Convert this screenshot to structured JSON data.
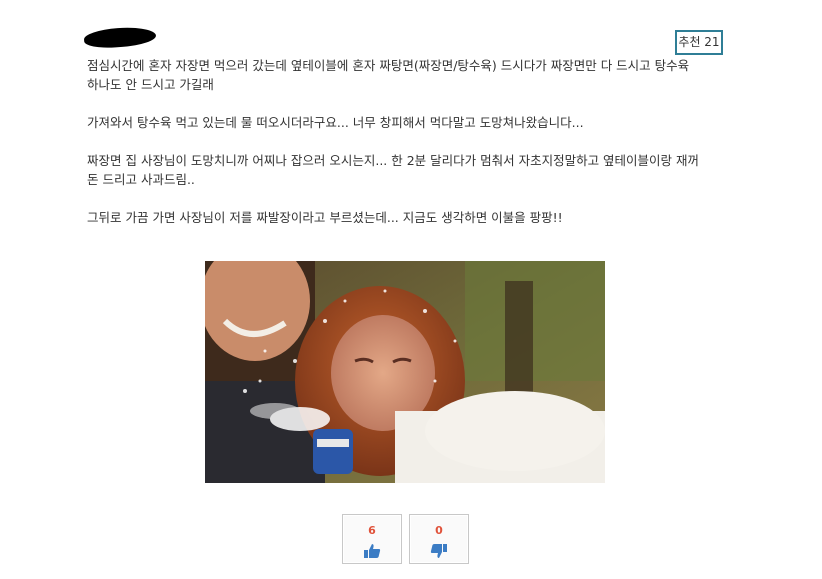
{
  "post": {
    "recommend_label": "추천 21",
    "paragraphs": [
      "점심시간에 혼자 자장면 먹으러 갔는데 옆테이블에 혼자 짜탕면(짜장면/탕수육) 드시다가 짜장면만 다 드시고 탕수육\n하나도 안 드시고 가길래",
      "가져와서 탕수육 먹고 있는데 물 떠오시더라구요... 너무 창피해서 먹다말고 도망쳐나왔습니다...",
      "짜장면 집 사장님이 도망치니까 어찌나 잡으러 오시는지... 한 2분 달리다가 멈춰서 자초지정말하고 옆테이블이랑 재꺼\n돈 드리고 사과드림..",
      "그뒤로 가끔 가면 사장님이 저를 짜발장이라고 부르셨는데... 지금도 생각하면 이불을 팡팡!!"
    ]
  },
  "votes": {
    "up_count": "6",
    "down_count": "0",
    "up_icon": "thumbs-up-icon",
    "down_icon": "thumbs-down-icon",
    "count_color": "#e0523a",
    "icon_color": "#3b7cc4"
  },
  "colors": {
    "badge_border": "#2f7e96",
    "text": "#333333"
  }
}
